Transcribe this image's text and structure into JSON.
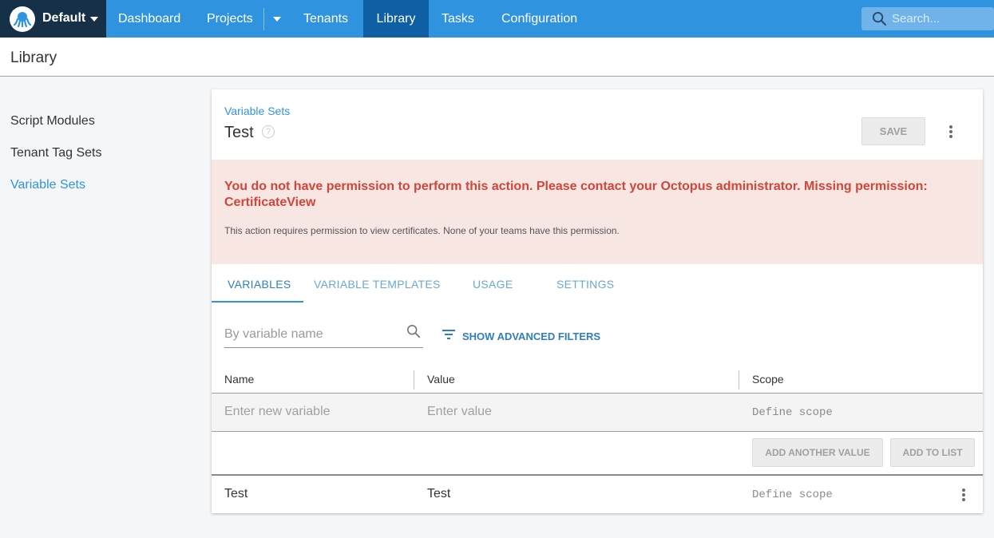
{
  "topnav": {
    "space_name": "Default",
    "items": [
      "Dashboard",
      "Projects",
      "Tenants",
      "Library",
      "Tasks",
      "Configuration"
    ],
    "active": "Library",
    "search_placeholder": "Search..."
  },
  "page": {
    "title": "Library"
  },
  "sidebar": {
    "items": [
      {
        "label": "Script Modules"
      },
      {
        "label": "Tenant Tag Sets"
      },
      {
        "label": "Variable Sets"
      }
    ],
    "active": "Variable Sets"
  },
  "card": {
    "breadcrumb": "Variable Sets",
    "title": "Test",
    "save_label": "SAVE",
    "alert": {
      "message": "You do not have permission to perform this action. Please contact your Octopus administrator. Missing permission: CertificateView",
      "detail": "This action requires permission to view certificates. None of your teams have this permission."
    },
    "tabs": [
      "VARIABLES",
      "VARIABLE TEMPLATES",
      "USAGE",
      "SETTINGS"
    ],
    "active_tab": "VARIABLES",
    "filter": {
      "placeholder": "By variable name",
      "advanced_label": "SHOW ADVANCED FILTERS"
    },
    "table": {
      "columns": [
        "Name",
        "Value",
        "Scope"
      ],
      "new_row": {
        "name_placeholder": "Enter new variable",
        "value_placeholder": "Enter value",
        "scope_placeholder": "Define scope"
      },
      "add_another_label": "ADD ANOTHER VALUE",
      "add_to_list_label": "ADD TO LIST",
      "rows": [
        {
          "name": "Test",
          "value": "Test",
          "scope": "Define scope"
        }
      ]
    }
  },
  "colors": {
    "nav_blue": "#2f93e0",
    "nav_active": "#0f5fa5",
    "space_dark": "#163147",
    "alert_bg": "#f8e6e3",
    "alert_text": "#d0463b"
  }
}
